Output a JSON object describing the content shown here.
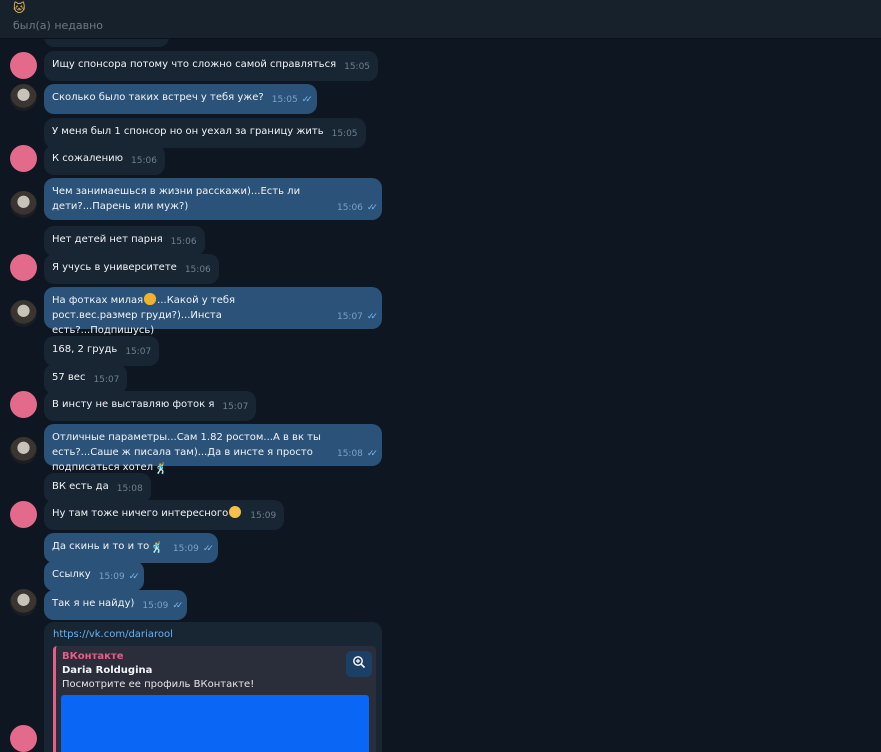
{
  "header": {
    "emoji": "🐱",
    "status": "был(а) недавно"
  },
  "messages": [
    {
      "dir": "in",
      "text": "Ищу спонсора потому что сложно самой справляться",
      "time": "15:05"
    },
    {
      "dir": "out",
      "text": "Сколько было таких встреч у тебя уже?",
      "time": "15:05"
    },
    {
      "dir": "in",
      "text": "У меня был 1 спонсор но он уехал за границу жить",
      "time": "15:05"
    },
    {
      "dir": "in",
      "text": "К сожалению",
      "time": "15:06"
    },
    {
      "dir": "out",
      "text": "Чем занимаешься в жизни расскажи)...Есть ли дети?...Парень или муж?)",
      "time": "15:06"
    },
    {
      "dir": "in",
      "text": "Нет детей нет парня",
      "time": "15:06"
    },
    {
      "dir": "in",
      "text": "Я учусь в университете",
      "time": "15:06"
    },
    {
      "dir": "out",
      "text": "На фотках милая",
      "text2": "...Какой у тебя рост.вес.размер груди?)...Инста есть?...Подпишусь)",
      "time": "15:07"
    },
    {
      "dir": "in",
      "text": "168, 2 грудь",
      "time": "15:07"
    },
    {
      "dir": "in",
      "text": "57 вес",
      "time": "15:07"
    },
    {
      "dir": "in",
      "text": "В инсту не выставляю фоток я",
      "time": "15:07"
    },
    {
      "dir": "out",
      "text": "Отличные параметры...Сам 1.82 ростом...А в вк ты есть?...Саше ж писала там)...Да в инсте я просто подписаться хотел",
      "time": "15:08"
    },
    {
      "dir": "in",
      "text": "ВК есть да",
      "time": "15:08"
    },
    {
      "dir": "in",
      "text": "Ну там тоже ничего интересного",
      "time": "15:09"
    },
    {
      "dir": "out",
      "text": "Да скинь и то и то",
      "time": "15:09"
    },
    {
      "dir": "out",
      "text": "Ссылку",
      "time": "15:09"
    },
    {
      "dir": "out",
      "text": "Так я не найду)",
      "time": "15:09"
    }
  ],
  "link_message": {
    "url": "https://vk.com/dariarool",
    "site": "ВКонтакте",
    "title": "Daria Roldugina",
    "description": "Посмотрите ее профиль ВКонтакте!"
  },
  "colors": {
    "background": "#0e1621",
    "incoming_bubble": "#182533",
    "outgoing_bubble": "#2b5278",
    "accent_link": "#6ab3f3",
    "vk_accent": "#e35f86",
    "avatar_pink": "#e46a8b"
  },
  "icons": {
    "read_ticks": "double-check-icon",
    "zoom": "zoom-in-icon"
  }
}
